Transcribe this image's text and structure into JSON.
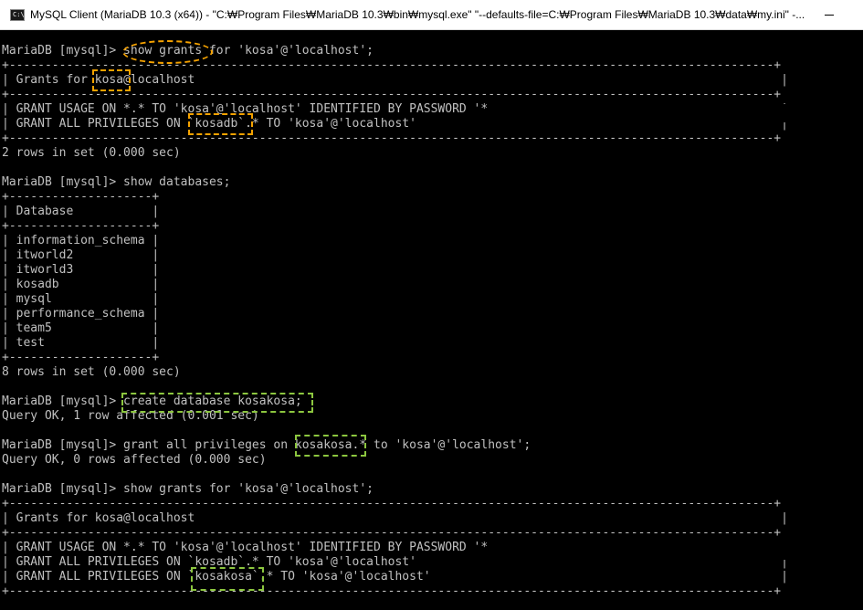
{
  "window": {
    "title": "MySQL Client (MariaDB 10.3 (x64)) - \"C:₩Program Files₩MariaDB 10.3₩bin₩mysql.exe\"  \"--defaults-file=C:₩Program Files₩MariaDB 10.3₩data₩my.ini\" -...",
    "icon_label": "C:\\"
  },
  "console": {
    "lines": [
      "MariaDB [mysql]> show grants for 'kosa'@'localhost';",
      "+-----------------------------------------------------------------------------------------------------------+",
      "| Grants for kosa@localhost                                                                                  |",
      "+-----------------------------------------------------------------------------------------------------------+",
      "| GRANT USAGE ON *.* TO 'kosa'@'localhost' IDENTIFIED BY PASSWORD '*                                         |",
      "| GRANT ALL PRIVILEGES ON `kosadb`.* TO 'kosa'@'localhost'                                                   |",
      "+-----------------------------------------------------------------------------------------------------------+",
      "2 rows in set (0.000 sec)",
      "",
      "MariaDB [mysql]> show databases;",
      "+--------------------+",
      "| Database           |",
      "+--------------------+",
      "| information_schema |",
      "| itworld2           |",
      "| itworld3           |",
      "| kosadb             |",
      "| mysql              |",
      "| performance_schema |",
      "| team5              |",
      "| test               |",
      "+--------------------+",
      "8 rows in set (0.000 sec)",
      "",
      "MariaDB [mysql]> create database kosakosa;",
      "Query OK, 1 row affected (0.001 sec)",
      "",
      "MariaDB [mysql]> grant all privileges on kosakosa.* to 'kosa'@'localhost';",
      "Query OK, 0 rows affected (0.000 sec)",
      "",
      "MariaDB [mysql]> show grants for 'kosa'@'localhost';",
      "+-----------------------------------------------------------------------------------------------------------+",
      "| Grants for kosa@localhost                                                                                  |",
      "+-----------------------------------------------------------------------------------------------------------+",
      "| GRANT USAGE ON *.* TO 'kosa'@'localhost' IDENTIFIED BY PASSWORD '*                                         |",
      "| GRANT ALL PRIVILEGES ON `kosadb`.* TO 'kosa'@'localhost'                                                   |",
      "| GRANT ALL PRIVILEGES ON `kosakosa`.* TO 'kosa'@'localhost'                                                 |",
      "+-----------------------------------------------------------------------------------------------------------+"
    ]
  },
  "colors": {
    "background": "#000000",
    "text": "#c0c0c0",
    "annotation_orange": "#f5a200",
    "annotation_green": "#8cc63f"
  }
}
